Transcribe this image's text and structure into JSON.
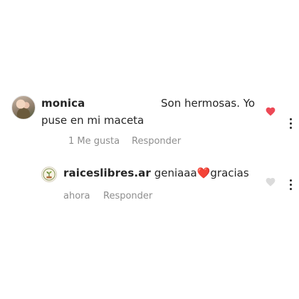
{
  "comments": [
    {
      "username": "monica",
      "text_line1": "Son hermosas. Yo",
      "text_line2": "puse en mi maceta",
      "likes": "1 Me gusta",
      "reply": "Responder",
      "liked": true,
      "heart_color": "#ed4956"
    },
    {
      "username": "raiceslibres.ar",
      "text_before": "geniaaa",
      "emoji": "❤️",
      "text_after": "gracias",
      "time": "ahora",
      "reply": "Responder",
      "liked": false,
      "heart_color": "#dbdbdb"
    }
  ],
  "colors": {
    "text": "#262626",
    "muted": "#8e8e8e",
    "like_red": "#ed4956"
  }
}
